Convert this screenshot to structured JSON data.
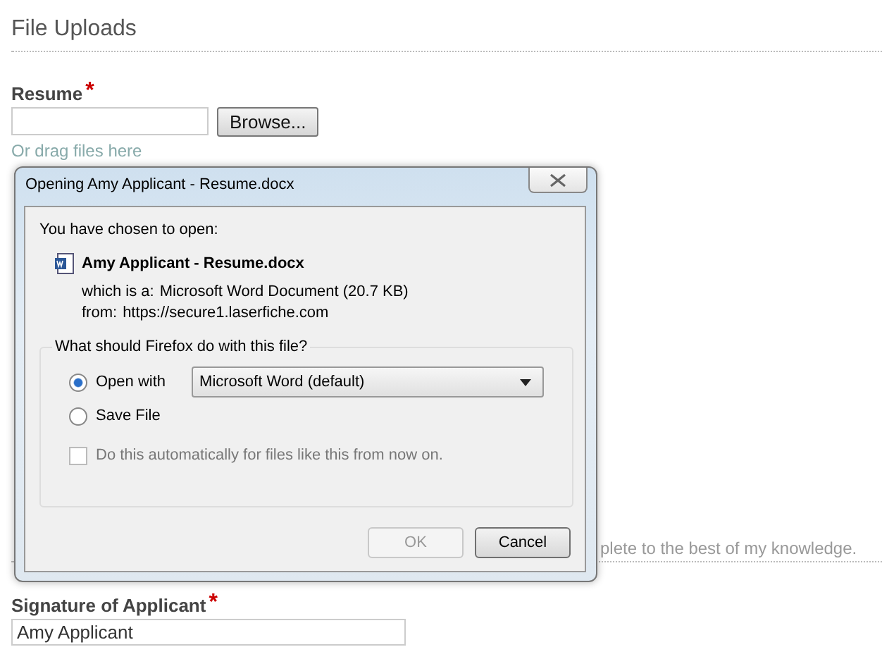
{
  "section_title": "File Uploads",
  "resume": {
    "label": "Resume",
    "required_mark": "*",
    "browse_button": "Browse...",
    "drop_hint": "Or drag files here"
  },
  "partial_statement": "plete to the best of my knowledge.",
  "signature": {
    "label": "Signature of Applicant",
    "required_mark": "*",
    "value": "Amy Applicant"
  },
  "dialog": {
    "title": "Opening Amy Applicant - Resume.docx",
    "intro": "You have chosen to open:",
    "file_name": "Amy Applicant - Resume.docx",
    "type_label": "which is a:",
    "type_value": "Microsoft Word Document (20.7 KB)",
    "from_label": "from:",
    "from_value": "https://secure1.laserfiche.com",
    "group_title": "What should Firefox do with this file?",
    "options": [
      {
        "label": "Open with",
        "selected": true
      },
      {
        "label": "Save File",
        "selected": false
      }
    ],
    "app_select": "Microsoft Word (default)",
    "auto_checkbox": {
      "label": "Do this automatically for files like this from now on.",
      "checked": false,
      "disabled": true
    },
    "buttons": [
      {
        "label": "OK",
        "disabled": true
      },
      {
        "label": "Cancel",
        "disabled": false
      }
    ]
  }
}
